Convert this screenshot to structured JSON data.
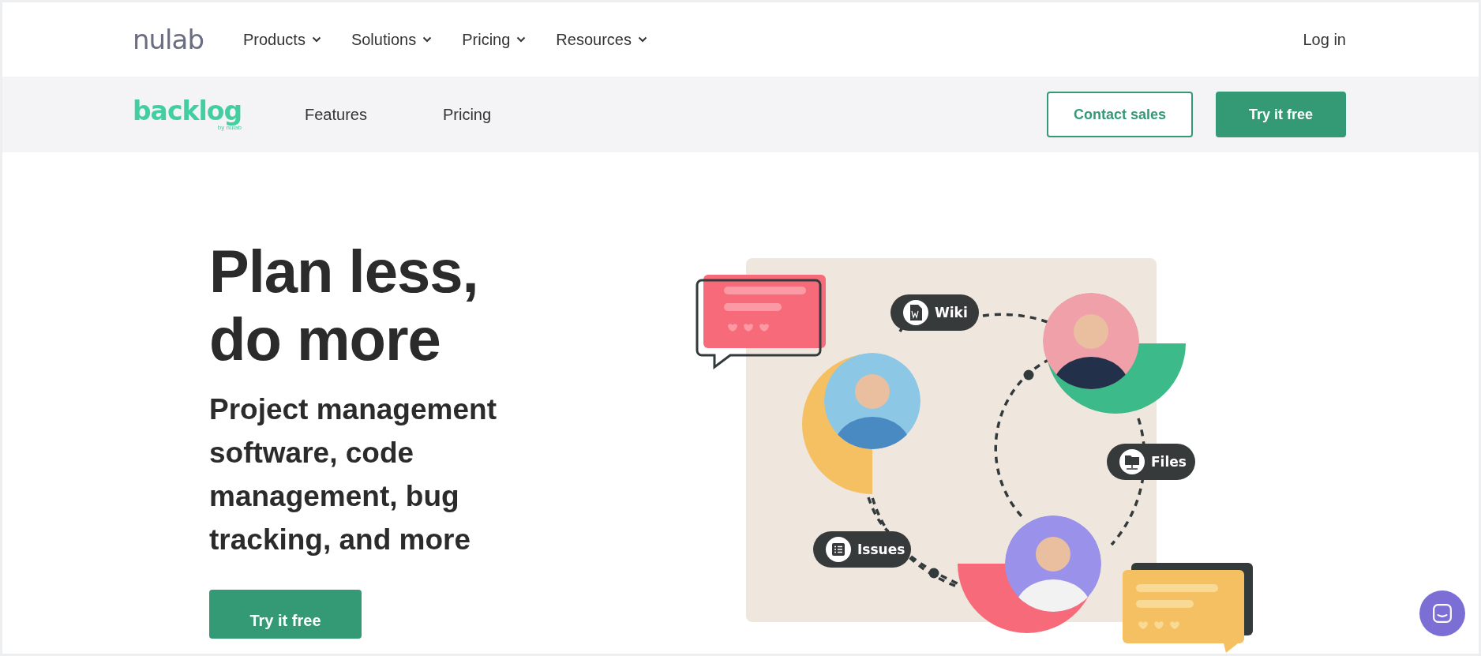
{
  "top_nav": {
    "logo": "nulab",
    "menu": [
      {
        "label": "Products"
      },
      {
        "label": "Solutions"
      },
      {
        "label": "Pricing"
      },
      {
        "label": "Resources"
      }
    ],
    "login": "Log in"
  },
  "product_bar": {
    "logo": "backlog",
    "logo_byline": "by nulab",
    "links": [
      "Features",
      "Pricing"
    ],
    "buttons": [
      {
        "label": "Contact sales",
        "kind": "outline"
      },
      {
        "label": "Try it free",
        "kind": "solid"
      }
    ]
  },
  "hero": {
    "title_lines": [
      "Plan less,",
      "do more"
    ],
    "subtitle": "Project management software, code management, bug tracking, and more",
    "cta": "Try it free"
  },
  "illustration": {
    "tags": [
      {
        "label": "Wiki",
        "kind": "wiki"
      },
      {
        "label": "Files",
        "kind": "files"
      },
      {
        "label": "Issues",
        "kind": "issues"
      }
    ]
  }
}
